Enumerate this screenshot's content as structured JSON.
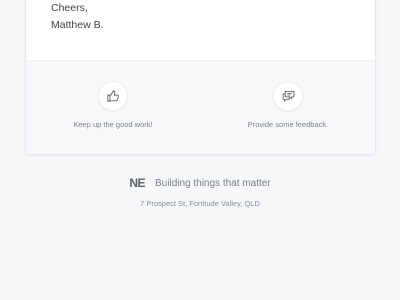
{
  "email": {
    "signoff": {
      "line1": "Cheers,",
      "line2": "Matthew B."
    },
    "actions": [
      {
        "icon": "thumbs-up-icon",
        "label": "Keep up the good work!"
      },
      {
        "icon": "chat-bubbles-icon",
        "label": "Provide some feedback."
      }
    ]
  },
  "footer": {
    "logo": "NE",
    "tagline": "Building things that matter",
    "address": "7 Prospect St, Fortitude Valley, QLD"
  },
  "colors": {
    "background": "#f6f7f9",
    "card": "#ffffff",
    "icon_stroke": "#5c636c"
  }
}
